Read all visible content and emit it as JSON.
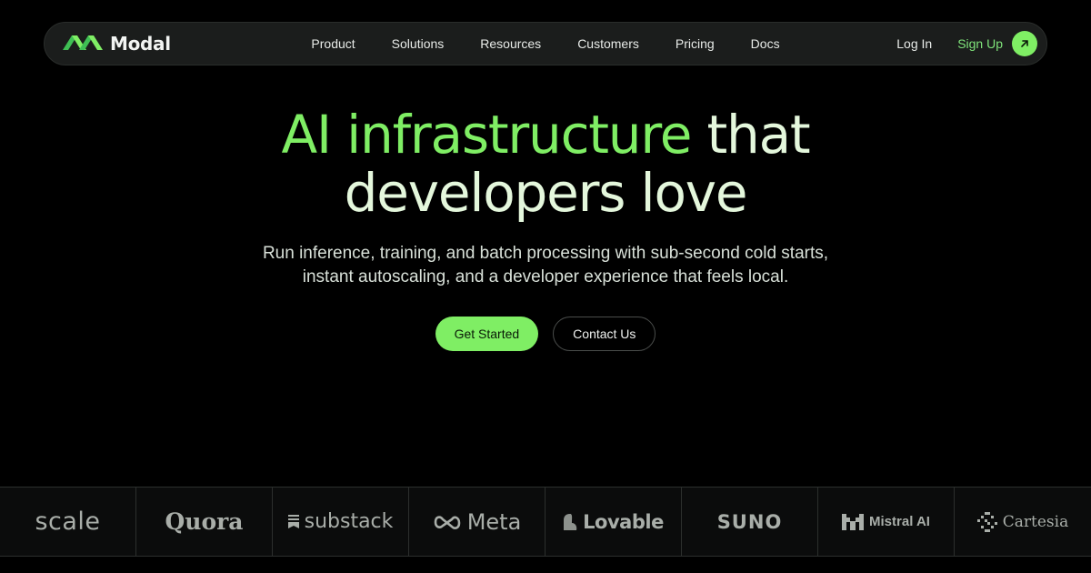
{
  "brand": {
    "name": "Modal",
    "accent_color": "#7fee64"
  },
  "nav": {
    "links": [
      "Product",
      "Solutions",
      "Resources",
      "Customers",
      "Pricing",
      "Docs"
    ],
    "login_label": "Log In",
    "signup_label": "Sign Up",
    "signup_icon": "arrow-up-right-icon"
  },
  "hero": {
    "title_accent": "AI infrastructure",
    "title_rest_line1": "that",
    "title_line2": "developers love",
    "subtitle": "Run inference, training, and batch processing with sub-second cold starts, instant autoscaling, and a developer experience that feels local.",
    "primary_cta": "Get Started",
    "secondary_cta": "Contact Us"
  },
  "customers": {
    "logos": [
      {
        "name": "scale",
        "icon": null
      },
      {
        "name": "Quora",
        "icon": null
      },
      {
        "name": "substack",
        "icon": "substack-icon"
      },
      {
        "name": "Meta",
        "icon": "meta-infinity-icon"
      },
      {
        "name": "Lovable",
        "icon": "lovable-heart-icon"
      },
      {
        "name": "SUNO",
        "icon": null
      },
      {
        "name": "Mistral AI",
        "icon": "mistral-icon"
      },
      {
        "name": "Cartesia",
        "icon": "cartesia-icon"
      }
    ]
  },
  "colors": {
    "background": "#000000",
    "nav_background": "#1b1d1c",
    "title_text": "#e4f7dc",
    "logo_gray": "#a9aea9"
  }
}
